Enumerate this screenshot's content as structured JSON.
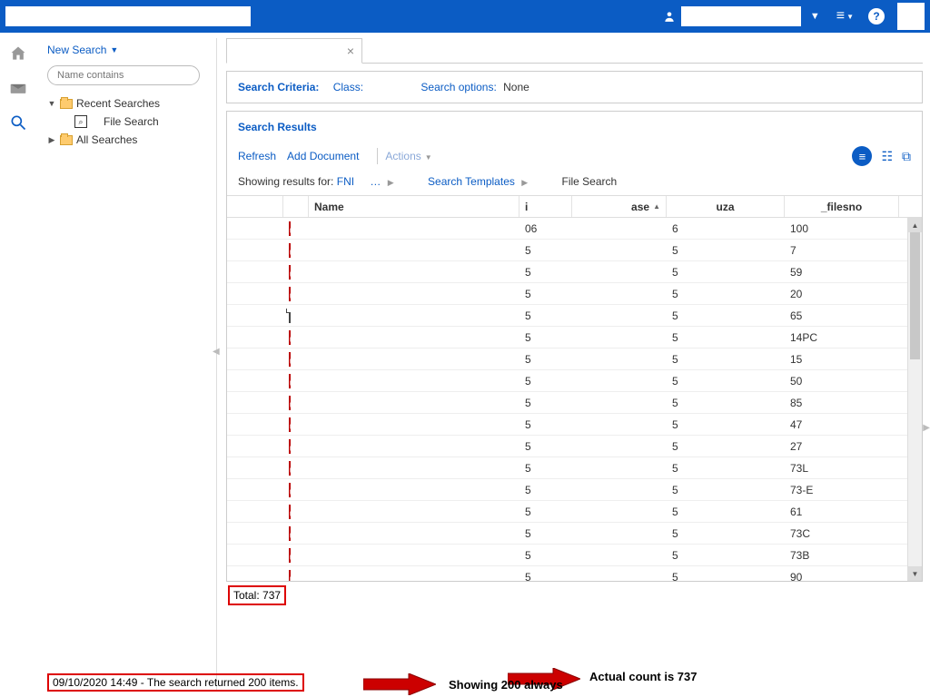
{
  "top": {
    "user_placeholder": ""
  },
  "nav": {
    "newSearch": "New Search",
    "filterPlaceholder": "Name contains",
    "recent": "Recent Searches",
    "fileSearch": "File Search",
    "all": "All Searches"
  },
  "criteria": {
    "label": "Search Criteria:",
    "class": "Class:",
    "options": "Search options:",
    "optionsVal": "None"
  },
  "results": {
    "title": "Search Results",
    "refresh": "Refresh",
    "addDoc": "Add Document",
    "actions": "Actions",
    "showing": "Showing results for:",
    "fni": "FNI",
    "dots": "…",
    "templates": "Search Templates",
    "fsearch": "File Search",
    "cols": {
      "name": "Name",
      "c3": "i",
      "c4": "ase",
      "c5": "uza",
      "c6": "_filesno"
    },
    "rows": [
      {
        "icon": "pdf",
        "c3": "06",
        "c5": "6",
        "c6": "100"
      },
      {
        "icon": "pdf",
        "c3": "5",
        "c5": "5",
        "c6": "7"
      },
      {
        "icon": "pdf",
        "c3": "5",
        "c5": "5",
        "c6": "59"
      },
      {
        "icon": "pdf",
        "c3": "5",
        "c5": "5",
        "c6": "20"
      },
      {
        "icon": "doc",
        "c3": "5",
        "c5": "5",
        "c6": "65"
      },
      {
        "icon": "pdf",
        "c3": "5",
        "c5": "5",
        "c6": "14PC"
      },
      {
        "icon": "pdf",
        "c3": "5",
        "c5": "5",
        "c6": "15"
      },
      {
        "icon": "pdf",
        "c3": "5",
        "c5": "5",
        "c6": "50"
      },
      {
        "icon": "pdf",
        "c3": "5",
        "c5": "5",
        "c6": "85"
      },
      {
        "icon": "pdf",
        "c3": "5",
        "c5": "5",
        "c6": "47"
      },
      {
        "icon": "pdf",
        "c3": "5",
        "c5": "5",
        "c6": "27"
      },
      {
        "icon": "pdf",
        "c3": "5",
        "c5": "5",
        "c6": "73L"
      },
      {
        "icon": "pdf",
        "c3": "5",
        "c5": "5",
        "c6": "73-E"
      },
      {
        "icon": "pdf",
        "c3": "5",
        "c5": "5",
        "c6": "61"
      },
      {
        "icon": "pdf",
        "c3": "5",
        "c5": "5",
        "c6": "73C"
      },
      {
        "icon": "pdf",
        "c3": "5",
        "c5": "5",
        "c6": "73B"
      },
      {
        "icon": "pdf",
        "c3": "5",
        "c5": "5",
        "c6": "90"
      }
    ],
    "total": "Total: 737"
  },
  "status": "09/10/2020 14:49 - The search returned 200 items.",
  "annot": {
    "a1": "Actual count is 737",
    "a2": "Showing 200 always"
  }
}
